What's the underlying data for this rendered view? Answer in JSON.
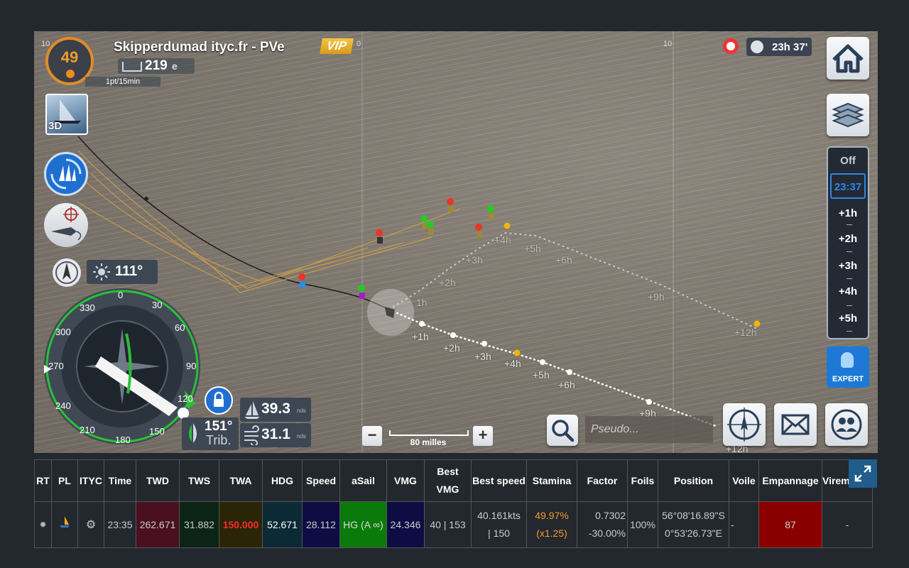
{
  "header": {
    "player_name": "Skipperdumad ityc.fr - PVe",
    "vip_label": "VIP",
    "level": "49",
    "rank": "219",
    "rank_suffix": "e",
    "points_rate": "1pt/15min",
    "remaining_time": "23h 37'"
  },
  "map": {
    "grid_labels": [
      "10",
      "0",
      "10"
    ],
    "forecast_labels_right": [
      "+1h",
      "+2h",
      "+3h",
      "+4h",
      "+5h",
      "+6h",
      "+9h",
      "+12h"
    ],
    "forecast_labels_upper": [
      "1h",
      "+2h",
      "+3h",
      "+4h",
      "+5h",
      "+6h",
      "+9h",
      "+12h"
    ],
    "scale_label": "80 milles",
    "search_placeholder": "Pseudo..."
  },
  "left_controls": {
    "view_3d_label": "3D",
    "wind_direction": "111°",
    "compass_ticks": [
      "0",
      "30",
      "60",
      "90",
      "120",
      "150",
      "180",
      "210",
      "240",
      "270",
      "300",
      "330"
    ],
    "heading_value": "151°",
    "heading_mode": "Trib.",
    "boat_speed": "39.3",
    "wind_speed": "31.1",
    "speed_unit": "nds"
  },
  "timeline": {
    "off_label": "Off",
    "current": "23:37",
    "steps": [
      "+1h",
      "+2h",
      "+3h",
      "+4h",
      "+5h"
    ],
    "expert_label": "EXPERT"
  },
  "table": {
    "headers": [
      "RT",
      "PL",
      "ITYC",
      "Time",
      "TWD",
      "TWS",
      "TWA",
      "HDG",
      "Speed",
      "aSail",
      "VMG",
      "Best VMG",
      "Best speed",
      "Stamina",
      "Factor",
      "Foils",
      "Position",
      "Voile",
      "Empannage",
      "Virement"
    ],
    "row": {
      "time": "23:35",
      "twd": "262.671",
      "tws": "31.882",
      "twa": "150.000",
      "hdg": "52.671",
      "speed": "28.112",
      "asail": "HG (A ∞)",
      "vmg": "24.346",
      "best_vmg": "40 | 153",
      "best_speed_1": "40.161kts",
      "best_speed_2": "| 150",
      "stamina_1": "49.97%",
      "stamina_2": "(x1.25)",
      "factor_1": "0.7302",
      "factor_2": "-30.00%",
      "foils": "100%",
      "position_1": "56°08'16.89\"S",
      "position_2": "0°53'26.73\"E",
      "voile": "-",
      "empannage": "87",
      "virement": "-"
    },
    "colors": {
      "twd_bg": "#4a1020",
      "tws_bg": "#0b2415",
      "twa_bg": "#2b2508",
      "twa_text": "#ff2a2a",
      "hdg_bg": "#0b2a36",
      "speed_bg": "#0d0d44",
      "asail_bg": "#0a7a0a",
      "vmg_bg": "#0d0d44",
      "stamina_text": "#f49b2e",
      "empannage_bg": "#8a0000"
    }
  }
}
